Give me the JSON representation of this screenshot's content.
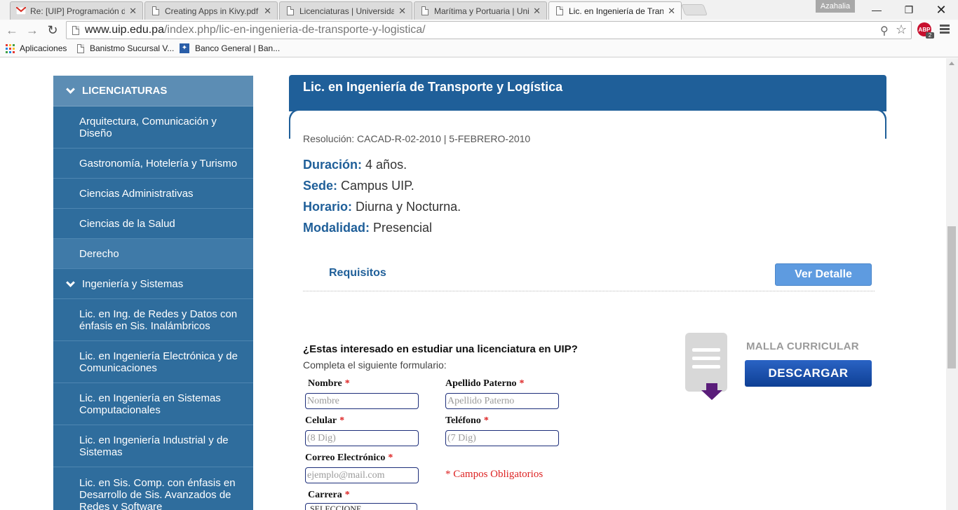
{
  "browser": {
    "tabs": [
      {
        "title": "Re: [UIP] Programación de",
        "icon": "gmail-icon"
      },
      {
        "title": "Creating Apps in Kivy.pdf",
        "icon": "page-icon"
      },
      {
        "title": "Licenciaturas | Universidad",
        "icon": "page-icon"
      },
      {
        "title": "Marítima y Portuaria | Univ",
        "icon": "page-icon"
      },
      {
        "title": "Lic. en Ingeniería de Trans",
        "icon": "page-icon",
        "active": true
      }
    ],
    "profile_name": "Azahalia",
    "url_host": "www.uip.edu.pa",
    "url_path": "/index.php/lic-en-ingenieria-de-transporte-y-logistica/",
    "abp_label": "ABP",
    "abp_count": "2",
    "bookmarks": [
      {
        "label": "Aplicaciones"
      },
      {
        "label": "Banistmo Sucursal V..."
      },
      {
        "label": "Banco General | Ban..."
      }
    ]
  },
  "sidebar": {
    "header": "LICENCIATURAS",
    "items": [
      {
        "label": "Arquitectura, Comunicación y Diseño"
      },
      {
        "label": "Gastronomía, Hotelería y Turismo"
      },
      {
        "label": "Ciencias Administrativas"
      },
      {
        "label": "Ciencias de la Salud"
      },
      {
        "label": "Derecho"
      },
      {
        "label": "Ingeniería y Sistemas"
      },
      {
        "label": "Lic. en Ing. de Redes y Datos con énfasis en Sis. Inalámbricos"
      },
      {
        "label": "Lic. en Ingeniería Electrónica y de Comunicaciones"
      },
      {
        "label": "Lic. en Ingeniería en Sistemas Computacionales"
      },
      {
        "label": "Lic. en Ingeniería Industrial y de Sistemas"
      },
      {
        "label": "Lic. en Sis. Comp. con énfasis en Desarrollo de Sis. Avanzados de Redes y Software"
      }
    ]
  },
  "program": {
    "title": "Lic. en Ingeniería de Transporte y Logística",
    "resolucion": "Resolución: CACAD-R-02-2010  |  5-FEBRERO-2010",
    "duracion_label": "Duración:",
    "duracion_value": "4 años.",
    "sede_label": "Sede:",
    "sede_value": "Campus UIP.",
    "horario_label": "Horario:",
    "horario_value": "Diurna y Nocturna.",
    "modalidad_label": "Modalidad:",
    "modalidad_value": "Presencial"
  },
  "requisitos": {
    "label": "Requisitos",
    "button": "Ver Detalle"
  },
  "form": {
    "question": "¿Estas interesado en estudiar una licenciatura en UIP?",
    "subtitle": "Completa el siguiente formulario:",
    "required_mark": "*",
    "nombre_label": "Nombre",
    "nombre_placeholder": "Nombre",
    "apellido_label": "Apellido Paterno",
    "apellido_placeholder": "Apellido Paterno",
    "celular_label": "Celular",
    "celular_placeholder": "(8 Dig)",
    "telefono_label": "Teléfono",
    "telefono_placeholder": "(7 Dig)",
    "correo_label": "Correo Electrónico",
    "correo_placeholder": "ejemplo@mail.com",
    "obligatorios": "* Campos Obligatorios",
    "carrera_label": "Carrera",
    "carrera_value": "SELECCIONE"
  },
  "malla": {
    "title": "MALLA CURRICULAR",
    "button": "DESCARGAR"
  },
  "colors": {
    "brand_blue": "#1f5f99",
    "sidebar_blue": "#2f6d9d",
    "required_red": "#dd2222"
  }
}
